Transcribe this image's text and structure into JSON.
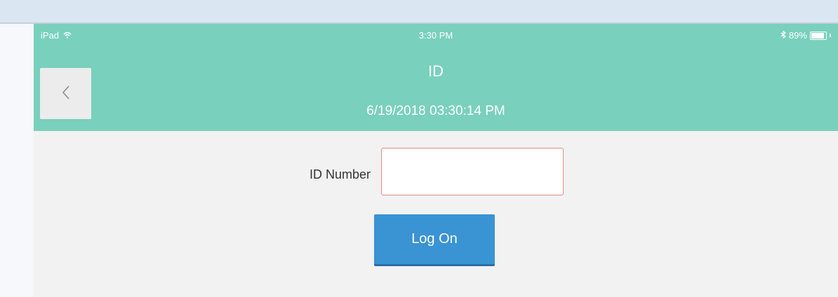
{
  "status_bar": {
    "device": "iPad",
    "time": "3:30 PM",
    "battery_percent": "89%",
    "battery_level": 0.89,
    "icons": [
      "wifi-icon",
      "bluetooth-icon",
      "battery-icon"
    ]
  },
  "header": {
    "title": "ID",
    "timestamp": "6/19/2018 03:30:14 PM",
    "back_icon": "chevron-left-icon",
    "background_color": "#79d0bd"
  },
  "form": {
    "id_label": "ID Number",
    "id_value": "",
    "id_placeholder": "",
    "logon_label": "Log On",
    "button_color": "#3a93d3",
    "input_border_color": "#e58a7b"
  }
}
